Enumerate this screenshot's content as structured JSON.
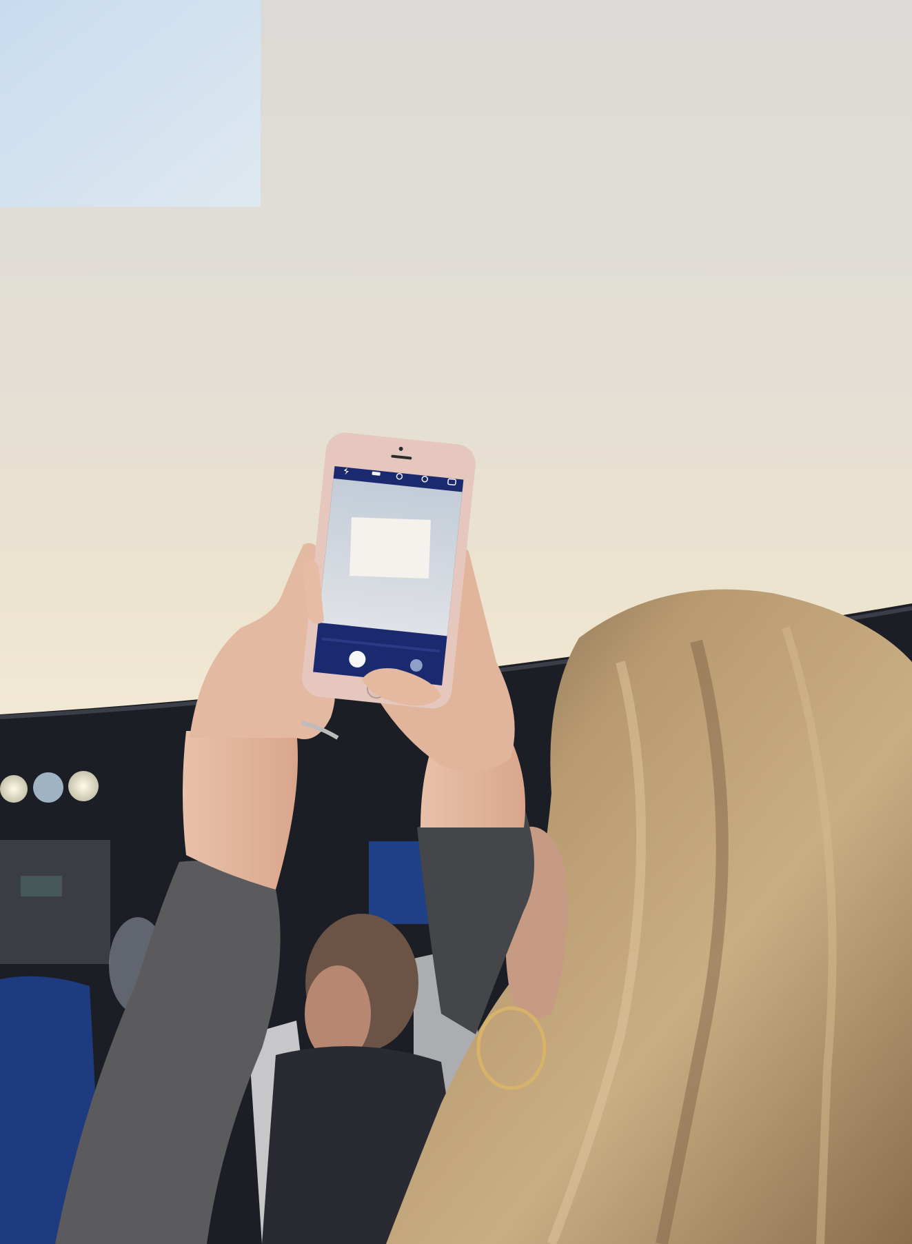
{
  "photo": {
    "subject": "",
    "colors": {
      "dome": "#e4dfd6",
      "dome_warm": "#efe6d0",
      "screen_panel": "#cfe0f0",
      "stage": "#1b1d24",
      "sweater": "#5b5b5d",
      "hair": "#b79a72",
      "seat_blue": "#1f3e86"
    }
  },
  "phone": {
    "status_icons": [
      "flash-icon",
      "hdr-icon",
      "live-photo-icon",
      "timer-icon",
      "camera-flip-icon"
    ],
    "zoom_left": "",
    "zoom_right": "",
    "modes": [],
    "active_mode": ""
  }
}
